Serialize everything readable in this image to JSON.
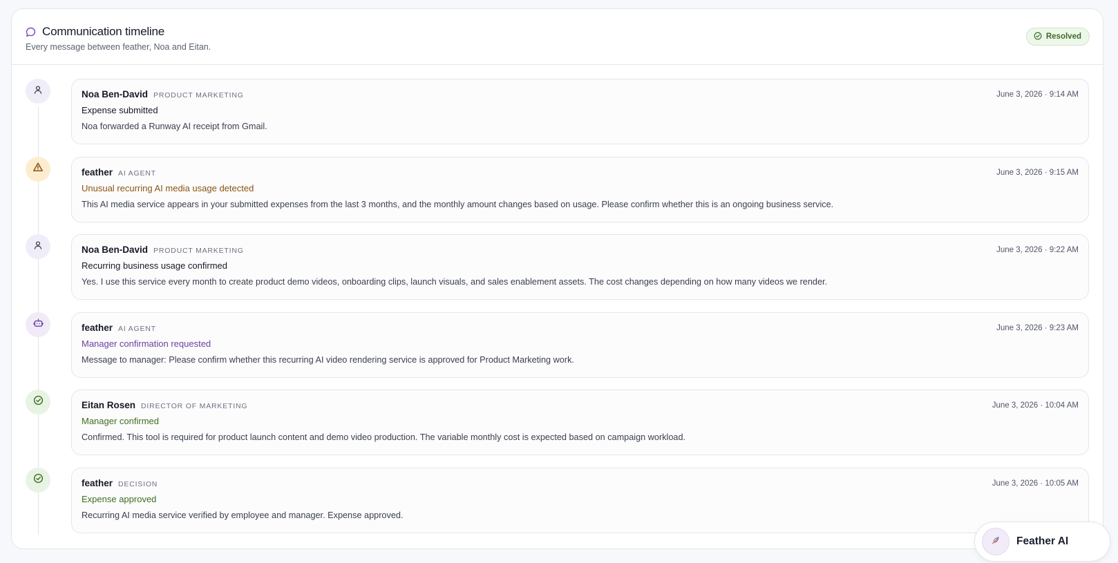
{
  "header": {
    "title": "Communication timeline",
    "subtitle": "Every message between feather, Noa and Eitan.",
    "status_badge": "Resolved"
  },
  "colors": {
    "accent_purple": "#7b4bbd",
    "warning_text": "#8a5410",
    "success_text": "#3f6d1f",
    "badge_bg": "#eef8ea"
  },
  "timeline": [
    {
      "icon": "user-icon",
      "author": "Noa Ben-David",
      "role": "PRODUCT MARKETING",
      "time": "June 3, 2026 · 9:14 AM",
      "event": "Expense submitted",
      "message": "Noa forwarded a Runway AI receipt from Gmail."
    },
    {
      "icon": "warning-icon",
      "author": "feather",
      "role": "AI AGENT",
      "time": "June 3, 2026 · 9:15 AM",
      "event": "Unusual recurring AI media usage detected",
      "message": "This AI media service appears in your submitted expenses from the last 3 months, and the monthly amount changes based on usage. Please confirm whether this is an ongoing business service."
    },
    {
      "icon": "user-icon",
      "author": "Noa Ben-David",
      "role": "PRODUCT MARKETING",
      "time": "June 3, 2026 · 9:22 AM",
      "event": "Recurring business usage confirmed",
      "message": "Yes. I use this service every month to create product demo videos, onboarding clips, launch visuals, and sales enablement assets. The cost changes depending on how many videos we render."
    },
    {
      "icon": "bot-icon",
      "author": "feather",
      "role": "AI AGENT",
      "time": "June 3, 2026 · 9:23 AM",
      "event": "Manager confirmation requested",
      "message": "Message to manager: Please confirm whether this recurring AI video rendering service is approved for Product Marketing work."
    },
    {
      "icon": "check-circle-icon",
      "author": "Eitan Rosen",
      "role": "DIRECTOR OF MARKETING",
      "time": "June 3, 2026 · 10:04 AM",
      "event": "Manager confirmed",
      "message": "Confirmed. This tool is required for product launch content and demo video production. The variable monthly cost is expected based on campaign workload."
    },
    {
      "icon": "check-circle-icon",
      "author": "feather",
      "role": "DECISION",
      "time": "June 3, 2026 · 10:05 AM",
      "event": "Expense approved",
      "message": "Recurring AI media service verified by employee and manager. Expense approved."
    }
  ],
  "assistant": {
    "label": "Feather AI"
  }
}
